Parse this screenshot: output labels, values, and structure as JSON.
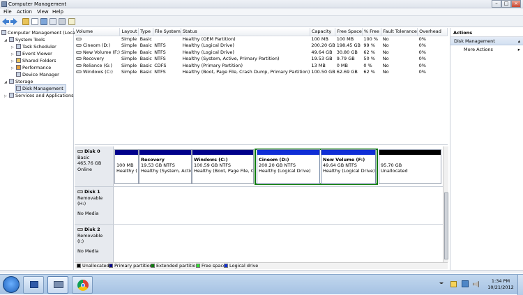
{
  "window": {
    "title": "Computer Management"
  },
  "menu": [
    "File",
    "Action",
    "View",
    "Help"
  ],
  "tree": {
    "root": "Computer Management (Local",
    "system_tools": "System Tools",
    "task_scheduler": "Task Scheduler",
    "event_viewer": "Event Viewer",
    "shared_folders": "Shared Folders",
    "performance": "Performance",
    "device_manager": "Device Manager",
    "storage": "Storage",
    "disk_management": "Disk Management",
    "services": "Services and Applications"
  },
  "volumes": {
    "columns": [
      "Volume",
      "Layout",
      "Type",
      "File System",
      "Status",
      "Capacity",
      "Free Space",
      "% Free",
      "Fault Tolerance",
      "Overhead"
    ],
    "rows": [
      [
        "",
        "Simple",
        "Basic",
        "",
        "Healthy (OEM Partition)",
        "100 MB",
        "100 MB",
        "100 %",
        "No",
        "0%"
      ],
      [
        "Cineom (D:)",
        "Simple",
        "Basic",
        "NTFS",
        "Healthy (Logical Drive)",
        "200.20 GB",
        "198.45 GB",
        "99 %",
        "No",
        "0%"
      ],
      [
        "New Volume (F:)",
        "Simple",
        "Basic",
        "NTFS",
        "Healthy (Logical Drive)",
        "49.64 GB",
        "30.80 GB",
        "62 %",
        "No",
        "0%"
      ],
      [
        "Recovery",
        "Simple",
        "Basic",
        "NTFS",
        "Healthy (System, Active, Primary Partition)",
        "19.53 GB",
        "9.79 GB",
        "50 %",
        "No",
        "0%"
      ],
      [
        "Reliance (G:)",
        "Simple",
        "Basic",
        "CDFS",
        "Healthy (Primary Partition)",
        "13 MB",
        "0 MB",
        "0 %",
        "No",
        "0%"
      ],
      [
        "Windows (C:)",
        "Simple",
        "Basic",
        "NTFS",
        "Healthy (Boot, Page File, Crash Dump, Primary Partition)",
        "100.50 GB",
        "62.69 GB",
        "62 %",
        "No",
        "0%"
      ]
    ]
  },
  "disk0": {
    "name": "Disk 0",
    "type": "Basic",
    "size": "465.76 GB",
    "state": "Online",
    "oem": {
      "size": "100 MB",
      "status": "Healthy ("
    },
    "recovery": {
      "name": "Recovery",
      "size": "19.53 GB NTFS",
      "status": "Healthy (System, Active"
    },
    "windows": {
      "name": "Windows  (C:)",
      "size": "100.59 GB NTFS",
      "status": "Healthy (Boot, Page File, Cr"
    },
    "cineom": {
      "name": "Cineom  (D:)",
      "size": "200.20 GB NTFS",
      "status": "Healthy (Logical Drive)"
    },
    "newvol": {
      "name": "New Volume  (F:)",
      "size": "49.64 GB NTFS",
      "status": "Healthy (Logical Drive)"
    },
    "unalloc": {
      "size": "95.70 GB",
      "status": "Unallocated"
    }
  },
  "disk1": {
    "name": "Disk 1",
    "type": "Removable (H:)",
    "media": "No Media"
  },
  "disk2": {
    "name": "Disk 2",
    "type": "Removable (I:)",
    "media": "No Media"
  },
  "legend": [
    "Unallocated",
    "Primary partition",
    "Extended partition",
    "Free space",
    "Logical drive"
  ],
  "actions": {
    "header": "Actions",
    "section": "Disk Management",
    "more": "More Actions"
  },
  "taskbar": {
    "time": "1:34 PM",
    "date": "10/21/2012"
  },
  "colors": {
    "primary": "#00008b",
    "extended": "#0a7a0a",
    "free": "#33e033",
    "logical": "#0f2ed6",
    "unallocated": "#000000"
  }
}
